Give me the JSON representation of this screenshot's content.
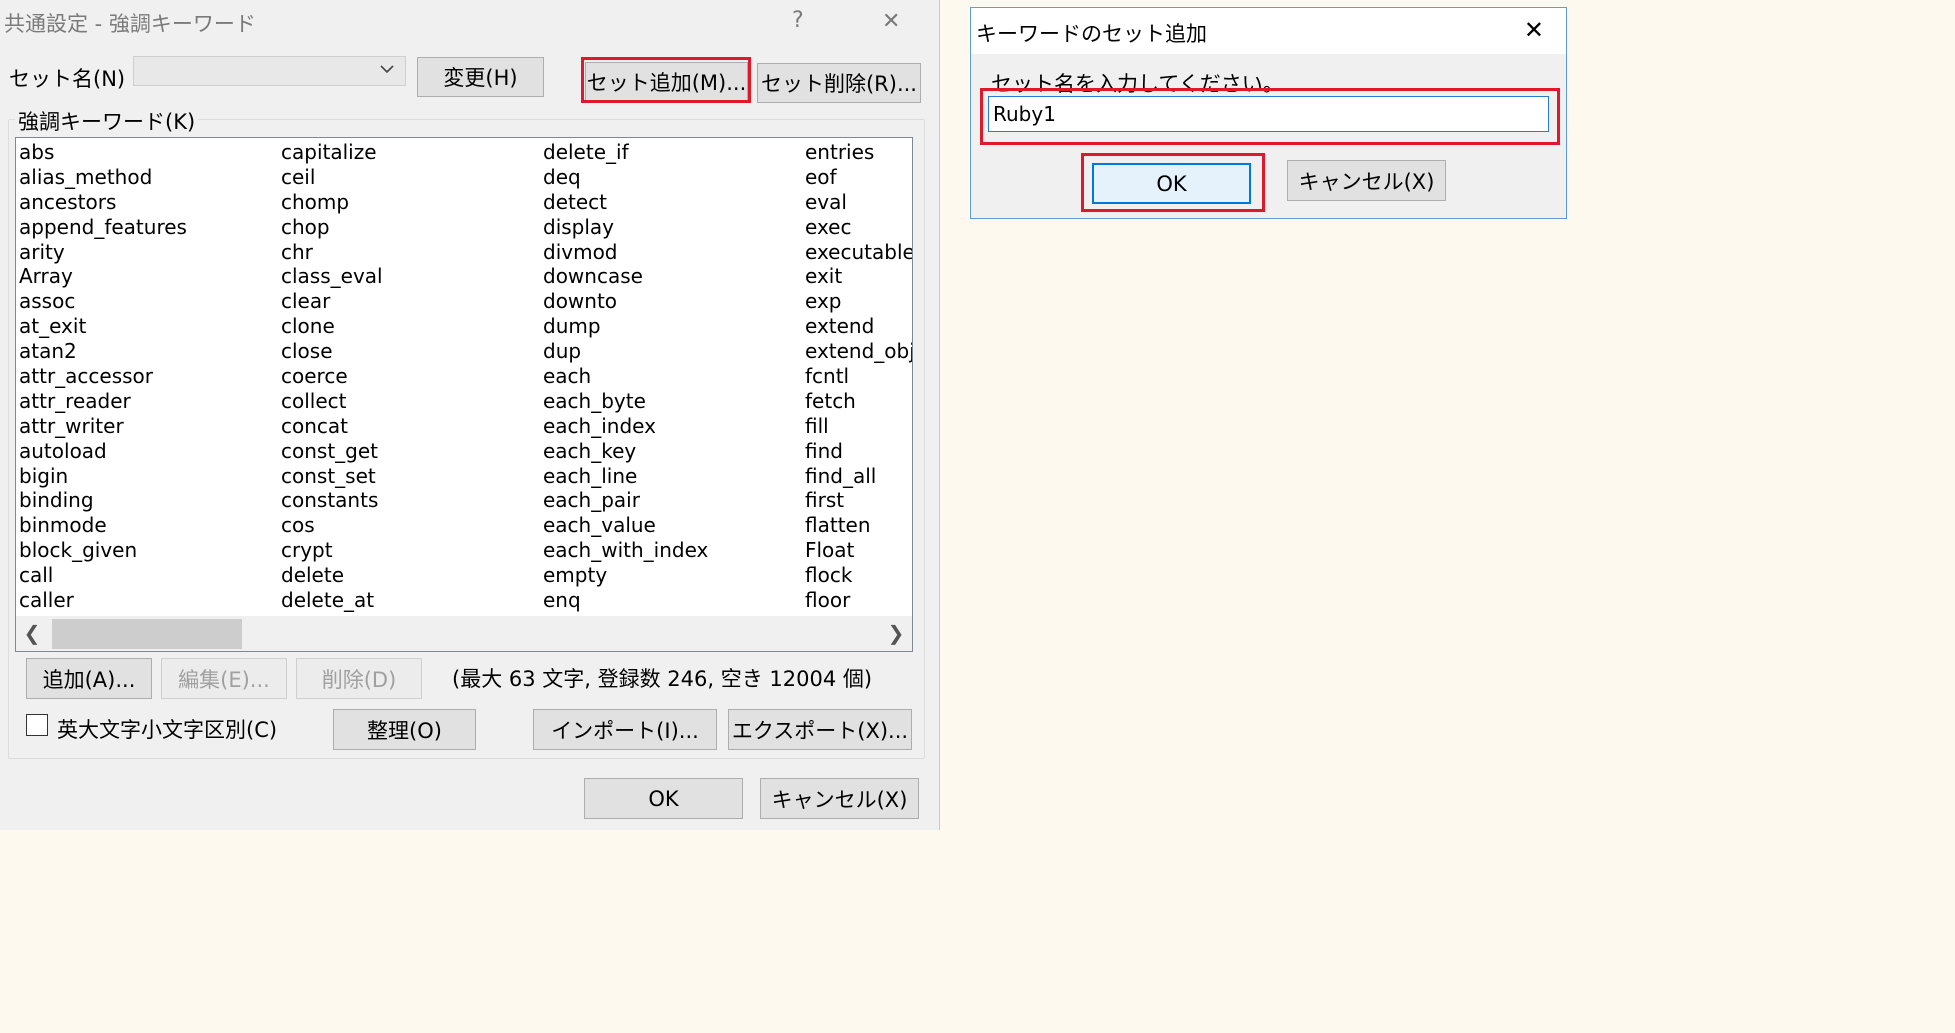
{
  "main_dialog": {
    "title": "共通設定 - 強調キーワード",
    "help_glyph": "?",
    "close_glyph": "✕",
    "set_name_label": "セット名(N)",
    "set_name_value": "",
    "change_button": "変更(H)",
    "add_set_button": "セット追加(M)...",
    "delete_set_button": "セット削除(R)...",
    "keywords_group_label": "強調キーワード(K)",
    "keywords": [
      [
        "abs",
        "alias_method",
        "ancestors",
        "append_features",
        "arity",
        "Array",
        "assoc",
        "at_exit",
        "atan2",
        "attr_accessor",
        "attr_reader",
        "attr_writer",
        "autoload",
        "bigin",
        "binding",
        "binmode",
        "block_given",
        "call",
        "caller"
      ],
      [
        "capitalize",
        "ceil",
        "chomp",
        "chop",
        "chr",
        "class_eval",
        "clear",
        "clone",
        "close",
        "coerce",
        "collect",
        "concat",
        "const_get",
        "const_set",
        "constants",
        "cos",
        "crypt",
        "delete",
        "delete_at"
      ],
      [
        "delete_if",
        "deq",
        "detect",
        "display",
        "divmod",
        "downcase",
        "downto",
        "dump",
        "dup",
        "each",
        "each_byte",
        "each_index",
        "each_key",
        "each_line",
        "each_pair",
        "each_value",
        "each_with_index",
        "empty",
        "enq"
      ],
      [
        "entries",
        "eof",
        "eval",
        "exec",
        "executable",
        "exit",
        "exp",
        "extend",
        "extend_obj",
        "fcntl",
        "fetch",
        "fill",
        "find",
        "find_all",
        "first",
        "flatten",
        "Float",
        "flock",
        "floor"
      ]
    ],
    "scroll_left": "❮",
    "scroll_right": "❯",
    "add_button": "追加(A)...",
    "edit_button": "編集(E)...",
    "delete_button": "削除(D)",
    "stats": "(最大 63 文字, 登録数 246, 空き 12004 個)",
    "case_checkbox_label": "英大文字小文字区別(C)",
    "case_checked": false,
    "organize_button": "整理(O)",
    "import_button": "インポート(I)...",
    "export_button": "エクスポート(X)...",
    "ok_button": "OK",
    "cancel_button": "キャンセル(X)"
  },
  "sub_dialog": {
    "title": "キーワードのセット追加",
    "close_glyph": "✕",
    "prompt": "セット名を入力してください。",
    "input_value": "Ruby1",
    "ok_button": "OK",
    "cancel_button": "キャンセル(X)"
  },
  "colors": {
    "highlight": "#e0192a",
    "accent": "#0078d7"
  }
}
